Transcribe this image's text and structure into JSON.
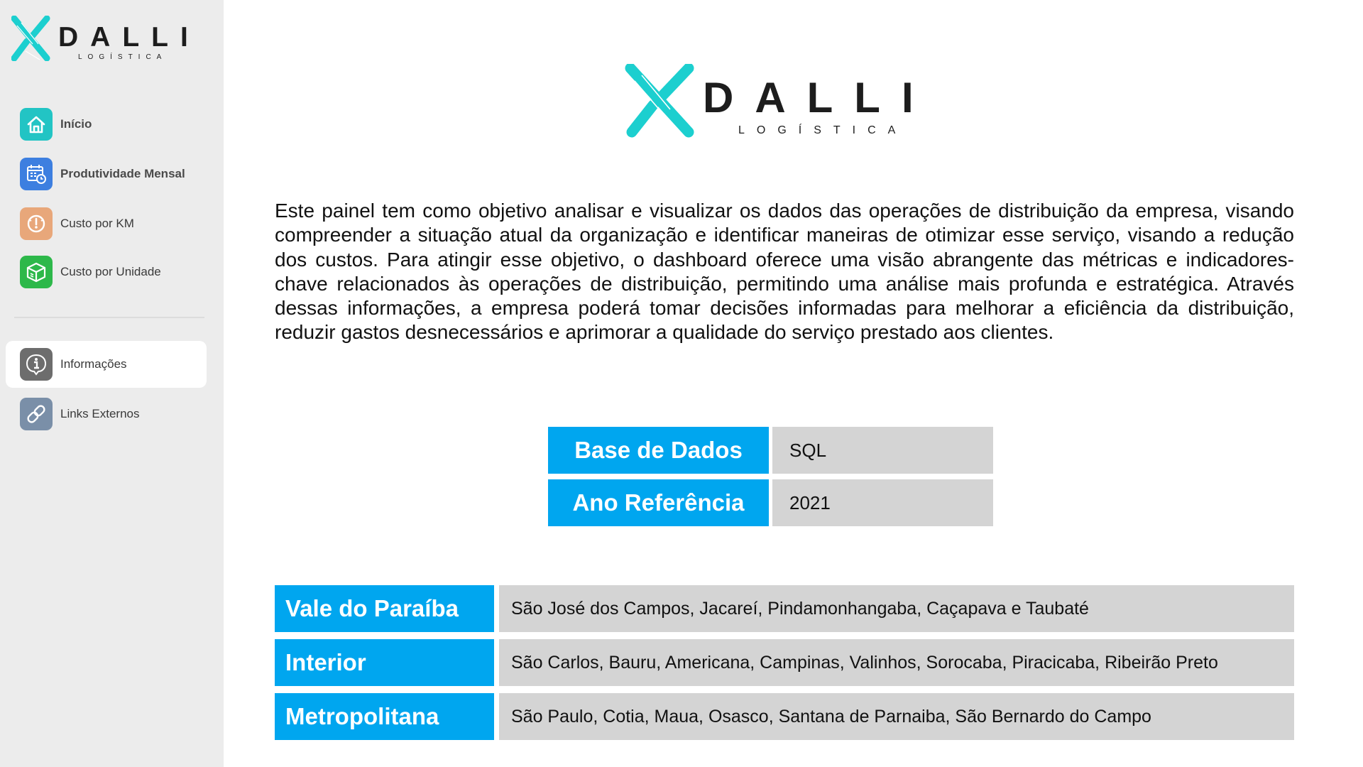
{
  "brand": {
    "name": "DALLI",
    "subtitle": "LOGÍSTICA",
    "colors": {
      "accent": "#1ccfcf",
      "dark": "#1d1d1d"
    }
  },
  "sidebar": {
    "items": [
      {
        "label": "Início",
        "icon": "home-icon",
        "color": "#22c4c4",
        "bold": true
      },
      {
        "label": "Produtividade Mensal",
        "icon": "calendar-clock-icon",
        "color": "#3d7fe0",
        "bold": true
      },
      {
        "label": "Custo por KM",
        "icon": "speedometer-icon",
        "color": "#e8a77a",
        "bold": false
      },
      {
        "label": "Custo por Unidade",
        "icon": "box-icon",
        "color": "#2db84a",
        "bold": false
      }
    ],
    "secondary_items": [
      {
        "label": "Informações",
        "icon": "info-icon",
        "color": "#6d6d6d",
        "active": true
      },
      {
        "label": "Links Externos",
        "icon": "link-icon",
        "color": "#7a8fa8",
        "active": false
      }
    ]
  },
  "main": {
    "description": "Este painel tem como objetivo analisar e visualizar os dados das operações de distribuição da empresa, visando compreender a situação atual da organização e identificar maneiras de otimizar esse serviço, visando a redução dos custos. Para atingir esse objetivo, o dashboard oferece uma visão abrangente das métricas e indicadores-chave relacionados às operações de distribuição, permitindo uma análise mais profunda e estratégica. Através dessas informações, a empresa poderá tomar decisões informadas para melhorar a eficiência da distribuição, reduzir gastos desnecessários e aprimorar a qualidade do serviço prestado aos clientes.",
    "meta": [
      {
        "label": "Base de Dados",
        "value": "SQL"
      },
      {
        "label": "Ano Referência",
        "value": "2021"
      }
    ],
    "regions": [
      {
        "name": "Vale do Paraíba",
        "cities": "São José dos Campos, Jacareí, Pindamonhangaba, Caçapava e Taubaté"
      },
      {
        "name": "Interior",
        "cities": "São Carlos, Bauru, Americana, Campinas, Valinhos, Sorocaba, Piracicaba, Ribeirão Preto"
      },
      {
        "name": "Metropolitana",
        "cities": "São Paulo, Cotia, Maua, Osasco, Santana de Parnaiba, São Bernardo do Campo"
      }
    ],
    "colors": {
      "label_bg": "#00a6ef",
      "value_bg": "#d4d4d4"
    }
  }
}
